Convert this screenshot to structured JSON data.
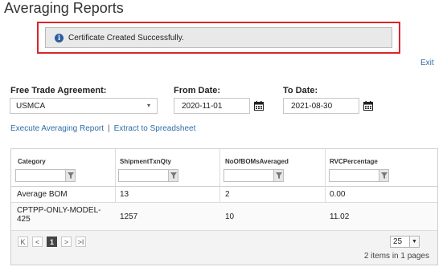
{
  "page": {
    "title": "Averaging Reports"
  },
  "alert": {
    "icon": "info-icon",
    "message": "Certificate Created Successfully."
  },
  "exit_label": "Exit",
  "form": {
    "fta_label": "Free Trade Agreement:",
    "fta_value": "USMCA",
    "from_label": "From Date:",
    "from_value": "2020-11-01",
    "to_label": "To Date:",
    "to_value": "2021-08-30"
  },
  "actions": {
    "execute": "Execute Averaging Report",
    "separator": "|",
    "extract": "Extract to Spreadsheet"
  },
  "grid": {
    "columns": [
      "Category",
      "ShipmentTxnQty",
      "NoOfBOMsAveraged",
      "RVCPercentage"
    ],
    "rows": [
      [
        "Average BOM",
        "13",
        "2",
        "0.00"
      ],
      [
        "CPTPP-ONLY-MODEL-\n425",
        "1257",
        "10",
        "11.02"
      ]
    ],
    "pager": {
      "first": "K",
      "prev": "<",
      "current_page": "1",
      "next": ">",
      "last": ">I",
      "page_size": "25",
      "info": "2 items in 1 pages"
    }
  },
  "colors": {
    "accent": "#2e6ea9",
    "alert_border": "#d9262b",
    "info": "#2c5e9f"
  }
}
